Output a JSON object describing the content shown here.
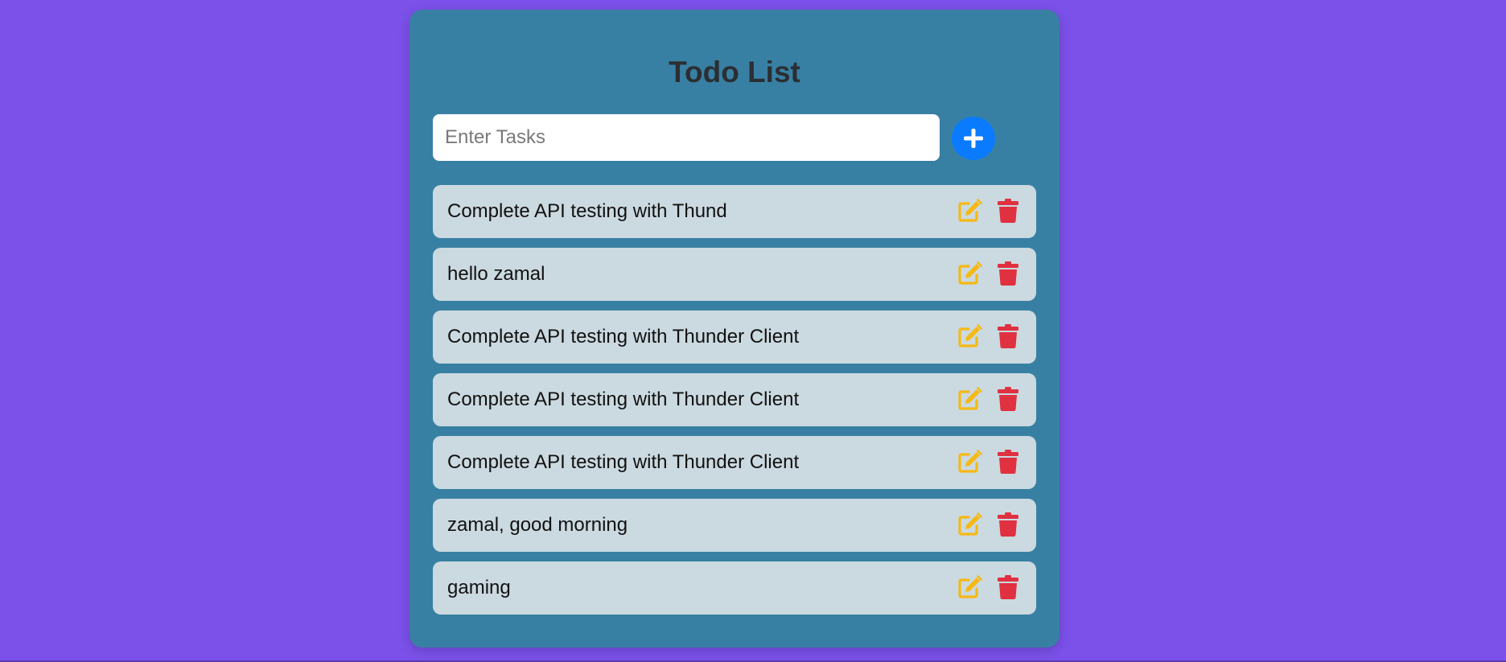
{
  "app": {
    "title": "Todo List"
  },
  "input": {
    "placeholder": "Enter Tasks",
    "value": ""
  },
  "icons": {
    "add": "plus-icon",
    "edit": "edit-icon",
    "delete": "trash-icon"
  },
  "colors": {
    "background": "#7b51ea",
    "card": "#3880a3",
    "item": "#cbd9e0",
    "add_button": "#0a7bff",
    "edit_icon": "#f5b914",
    "delete_icon": "#e03140",
    "title_text": "#2b2e33"
  },
  "tasks": [
    {
      "text": "Complete API testing with Thund"
    },
    {
      "text": "hello zamal"
    },
    {
      "text": "Complete API testing with Thunder Client"
    },
    {
      "text": "Complete API testing with Thunder Client"
    },
    {
      "text": "Complete API testing with Thunder Client"
    },
    {
      "text": "zamal, good morning"
    },
    {
      "text": "gaming"
    }
  ]
}
